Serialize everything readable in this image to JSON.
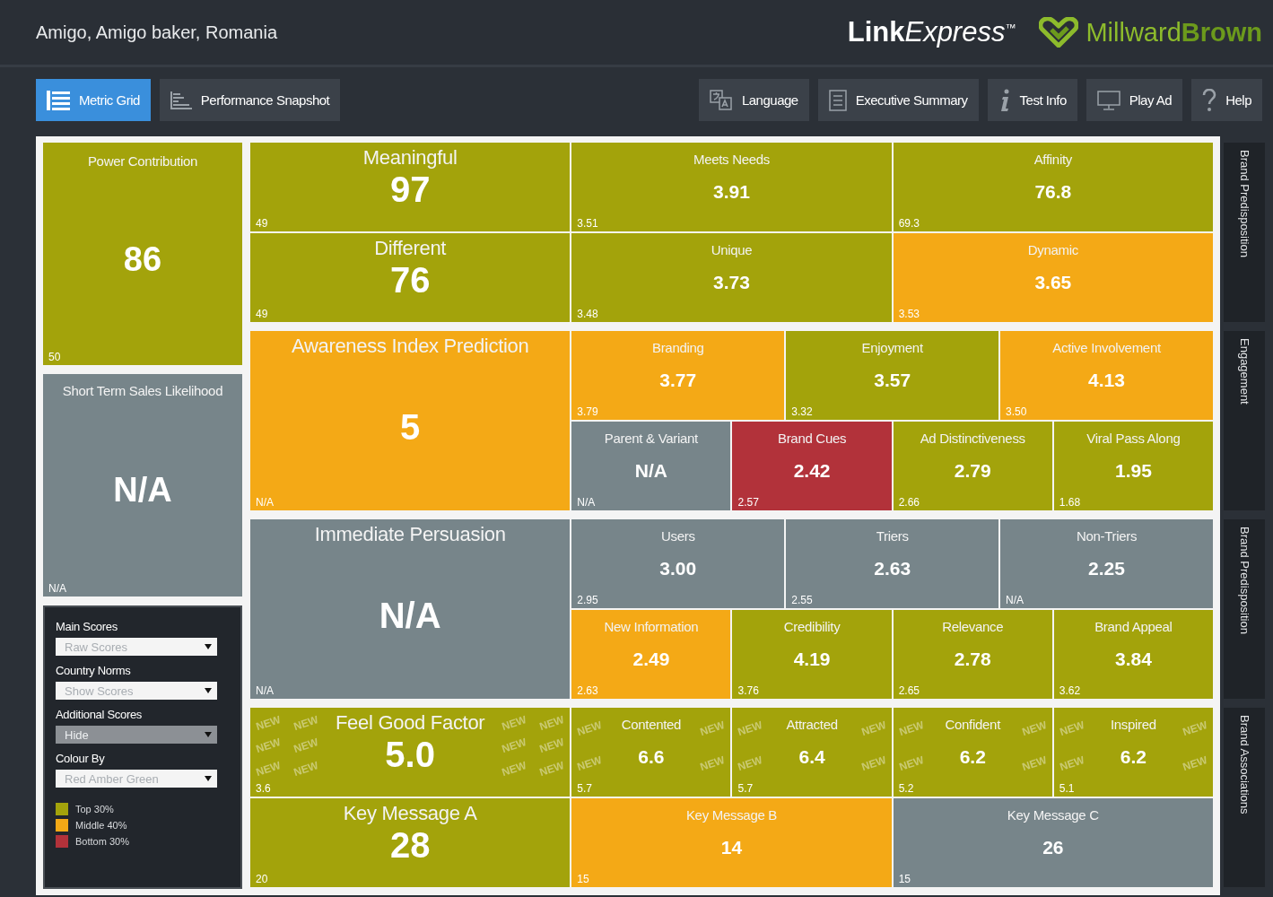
{
  "header": {
    "title": "Amigo, Amigo baker, Romania",
    "logos": [
      {
        "kind": "product",
        "parts": [
          {
            "text": "Link",
            "kind": "bold"
          },
          {
            "text": "Express",
            "kind": "italic"
          },
          {
            "text": "™",
            "kind": "mark"
          }
        ]
      },
      {
        "kind": "brand",
        "parts": [
          {
            "text": "Millward",
            "kind": "light"
          },
          {
            "text": "Brown",
            "kind": "strong"
          }
        ]
      }
    ]
  },
  "toolbar": {
    "left": [
      {
        "label": "Metric Grid",
        "kind": "list",
        "selected": true
      },
      {
        "label": "Performance Snapshot",
        "kind": "bars",
        "selected": false
      }
    ],
    "right": [
      {
        "label": "Language",
        "kind": "language"
      },
      {
        "label": "Executive Summary",
        "kind": "document"
      },
      {
        "label": "Test Info",
        "kind": "info"
      },
      {
        "label": "Play Ad",
        "kind": "monitor"
      },
      {
        "label": "Help",
        "kind": "help"
      }
    ]
  },
  "left_column": [
    {
      "title": "Power Contribution",
      "value": "86",
      "norm": "50",
      "color": "#a3a30b"
    },
    {
      "title": "Short Term Sales Likelihood",
      "value": "N/A",
      "norm": "N/A",
      "color": "#77858a"
    }
  ],
  "settings": {
    "fields": [
      {
        "label": "Main Scores",
        "value": "Raw Scores",
        "disabled": false
      },
      {
        "label": "Country Norms",
        "value": "Show Scores",
        "disabled": false
      },
      {
        "label": "Additional Scores",
        "value": "Hide",
        "disabled": true
      },
      {
        "label": "Colour By",
        "value": "Red Amber Green",
        "disabled": false
      }
    ],
    "legend": [
      {
        "label": "Top 30%",
        "color": "#a3a30b"
      },
      {
        "label": "Middle 40%",
        "color": "#f4a916"
      },
      {
        "label": "Bottom 30%",
        "color": "#b2323a"
      }
    ]
  },
  "sections": [
    {
      "tab": "Brand Predisposition",
      "kind": "grid",
      "cells": [
        {
          "title": "Meaningful",
          "value": "97",
          "norm": "49",
          "color": "#a3a30b",
          "lead": true
        },
        {
          "title": "Meets Needs",
          "value": "3.91",
          "norm": "3.51",
          "color": "#a3a30b",
          "lead": false
        },
        {
          "title": "Affinity",
          "value": "76.8",
          "norm": "69.3",
          "color": "#a3a30b",
          "lead": false
        },
        {
          "title": "Different",
          "value": "76",
          "norm": "49",
          "color": "#a3a30b",
          "lead": true
        },
        {
          "title": "Unique",
          "value": "3.73",
          "norm": "3.48",
          "color": "#a3a30b",
          "lead": false
        },
        {
          "title": "Dynamic",
          "value": "3.65",
          "norm": "3.53",
          "color": "#f4a916",
          "lead": false
        }
      ]
    },
    {
      "tab": "Engagement",
      "kind": "lead",
      "cells": [
        {
          "title": "Awareness Index Prediction",
          "value": "5",
          "norm": "N/A",
          "color": "#f4a916",
          "lead": true
        },
        {
          "title": "Branding",
          "value": "3.77",
          "norm": "3.79",
          "color": "#f4a916",
          "lead": false
        },
        {
          "title": "Enjoyment",
          "value": "3.57",
          "norm": "3.32",
          "color": "#a3a30b",
          "lead": false
        },
        {
          "title": "Active Involvement",
          "value": "4.13",
          "norm": "3.50",
          "color": "#f4a916",
          "lead": false
        },
        {
          "title": "Parent & Variant",
          "value": "N/A",
          "norm": "N/A",
          "color": "#77858a",
          "lead": false
        },
        {
          "title": "Brand Cues",
          "value": "2.42",
          "norm": "2.57",
          "color": "#b2323a",
          "lead": false
        },
        {
          "title": "Ad Distinctiveness",
          "value": "2.79",
          "norm": "2.66",
          "color": "#a3a30b",
          "lead": false
        },
        {
          "title": "Viral Pass Along",
          "value": "1.95",
          "norm": "1.68",
          "color": "#a3a30b",
          "lead": false
        }
      ]
    },
    {
      "tab": "Brand Predisposition",
      "kind": "lead",
      "cells": [
        {
          "title": "Immediate Persuasion",
          "value": "N/A",
          "norm": "N/A",
          "color": "#77858a",
          "lead": true
        },
        {
          "title": "Users",
          "value": "3.00",
          "norm": "2.95",
          "color": "#77858a",
          "lead": false
        },
        {
          "title": "Triers",
          "value": "2.63",
          "norm": "2.55",
          "color": "#77858a",
          "lead": false
        },
        {
          "title": "Non-Triers",
          "value": "2.25",
          "norm": "N/A",
          "color": "#77858a",
          "lead": false
        },
        {
          "title": "New Information",
          "value": "2.49",
          "norm": "2.63",
          "color": "#f4a916",
          "lead": false
        },
        {
          "title": "Credibility",
          "value": "4.19",
          "norm": "3.76",
          "color": "#a3a30b",
          "lead": false
        },
        {
          "title": "Relevance",
          "value": "2.78",
          "norm": "2.65",
          "color": "#a3a30b",
          "lead": false
        },
        {
          "title": "Brand Appeal",
          "value": "3.84",
          "norm": "3.62",
          "color": "#a3a30b",
          "lead": false
        }
      ]
    },
    {
      "tab": "Brand Associations",
      "kind": "split",
      "cells": [
        {
          "title": "Feel Good Factor",
          "value": "5.0",
          "norm": "3.6",
          "color": "#a3a30b",
          "lead": true,
          "watermarks": [
            "NEW",
            "NEW",
            "NEW",
            "NEW",
            "NEW",
            "NEW",
            "NEW",
            "NEW",
            "NEW",
            "NEW",
            "NEW",
            "NEW"
          ]
        },
        {
          "title": "Contented",
          "value": "6.6",
          "norm": "5.7",
          "color": "#a3a30b",
          "lead": false,
          "watermarks": [
            "NEW",
            "NEW",
            "NEW",
            "NEW"
          ]
        },
        {
          "title": "Attracted",
          "value": "6.4",
          "norm": "5.7",
          "color": "#a3a30b",
          "lead": false,
          "watermarks": [
            "NEW",
            "NEW",
            "NEW",
            "NEW"
          ]
        },
        {
          "title": "Confident",
          "value": "6.2",
          "norm": "5.2",
          "color": "#a3a30b",
          "lead": false,
          "watermarks": [
            "NEW",
            "NEW",
            "NEW",
            "NEW"
          ]
        },
        {
          "title": "Inspired",
          "value": "6.2",
          "norm": "5.1",
          "color": "#a3a30b",
          "lead": false,
          "watermarks": [
            "NEW",
            "NEW",
            "NEW",
            "NEW"
          ]
        },
        {
          "title": "Key Message A",
          "value": "28",
          "norm": "20",
          "color": "#a3a30b",
          "lead": true
        },
        {
          "title": "Key Message B",
          "value": "14",
          "norm": "15",
          "color": "#f4a916",
          "lead": false
        },
        {
          "title": "Key Message C",
          "value": "26",
          "norm": "15",
          "color": "#77858a",
          "lead": false
        }
      ]
    }
  ]
}
